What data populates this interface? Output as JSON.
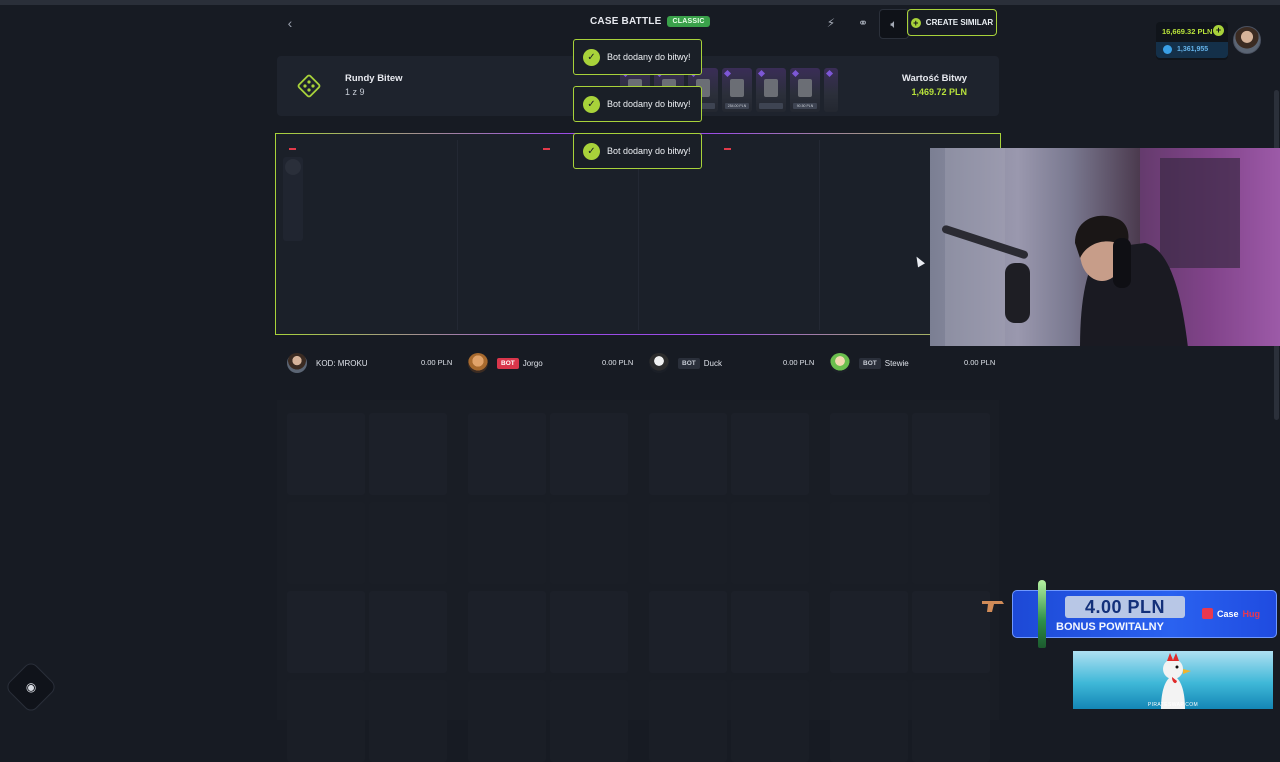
{
  "header": {
    "back_icon": "chevron-left-icon",
    "title": "CASE BATTLE",
    "mode_badge": "CLASSIC",
    "create_similar_label": "CREATE SIMILAR",
    "accent_color": "#a8d23a"
  },
  "wallet": {
    "balance": "16,669.32 PLN",
    "secondary_balance": "1,361,955"
  },
  "battle_info": {
    "rounds_label": "Rundy Bitew",
    "rounds_value": "1 z 9",
    "value_label": "Wartość Bitwy",
    "value_amount": "1,469.72 PLN",
    "case_prices": [
      "",
      "",
      "",
      "254.00 PLN",
      "",
      "90.50 PLN",
      "90.50 PLN"
    ]
  },
  "toasts": [
    {
      "message": "Bot dodany do bitwy!"
    },
    {
      "message": "Bot dodany do bitwy!"
    },
    {
      "message": "Bot dodany do bitwy!"
    }
  ],
  "players": [
    {
      "name": "KOD: MROKU",
      "is_bot": false,
      "bot_label": "",
      "value": "0.00 PLN"
    },
    {
      "name": "Jorgo",
      "is_bot": true,
      "bot_label": "BOT",
      "value": "0.00 PLN"
    },
    {
      "name": "Duck",
      "is_bot": true,
      "bot_label": "BOT",
      "value": "0.00 PLN"
    },
    {
      "name": "Stewie",
      "is_bot": true,
      "bot_label": "BOT",
      "value": "0.00 PLN"
    }
  ],
  "promo": {
    "amount": "4.00 PLN",
    "text": "BONUS POWITALNY",
    "brand_a": "Case",
    "brand_b": "Hug",
    "sponsor": "PIRATESWAP.COM"
  }
}
